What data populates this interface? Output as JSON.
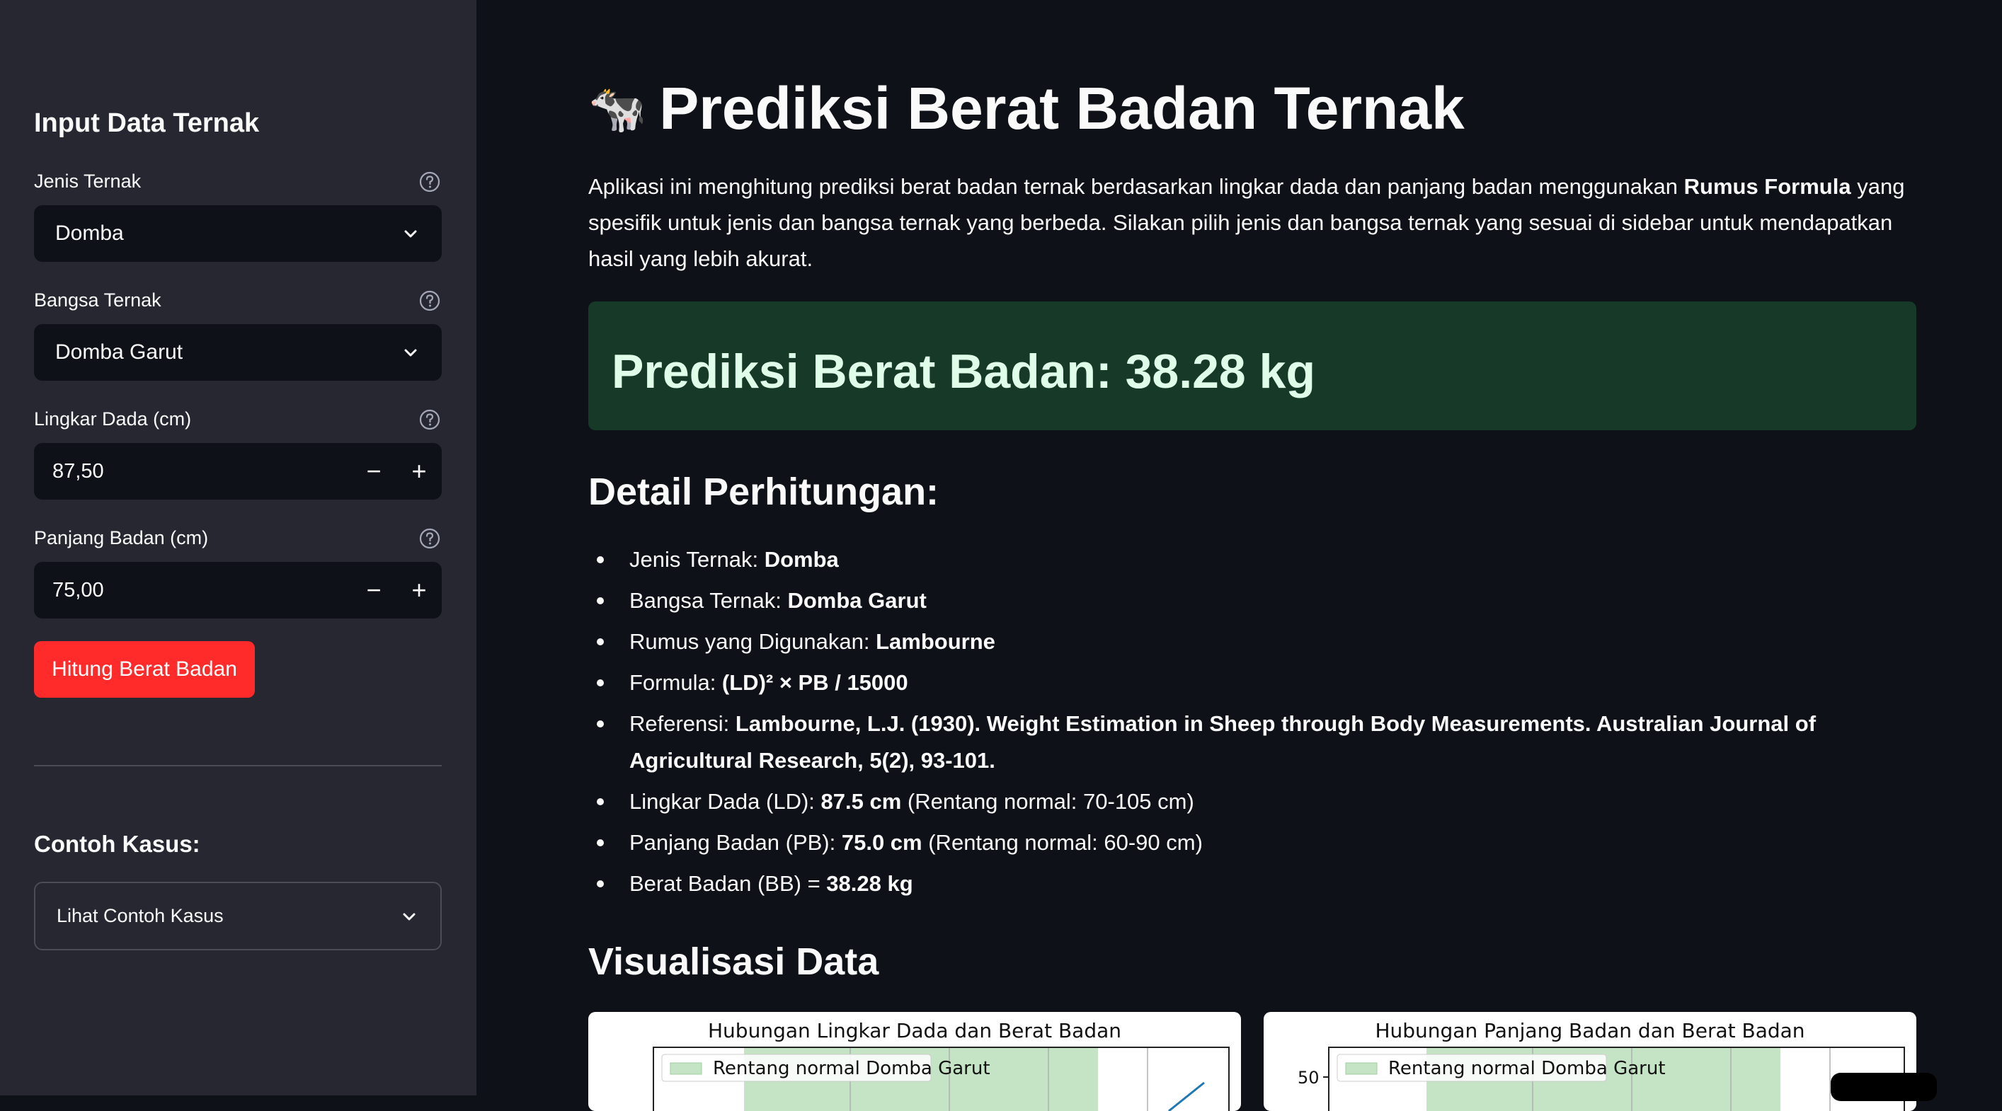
{
  "sidebar": {
    "title": "Input Data Ternak",
    "jenis": {
      "label": "Jenis Ternak",
      "value": "Domba"
    },
    "bangsa": {
      "label": "Bangsa Ternak",
      "value": "Domba Garut"
    },
    "lingkar": {
      "label": "Lingkar Dada (cm)",
      "value": "87,50"
    },
    "panjang": {
      "label": "Panjang Badan (cm)",
      "value": "75,00"
    },
    "button_label": "Hitung Berat Badan",
    "contoh_title": "Contoh Kasus:",
    "contoh_expander": "Lihat Contoh Kasus",
    "stepper_minus": "−",
    "stepper_plus": "+"
  },
  "main": {
    "title_icon": "🐄",
    "title": "Prediksi Berat Badan Ternak",
    "intro_1": "Aplikasi ini menghitung prediksi berat badan ternak berdasarkan lingkar dada dan panjang badan menggunakan ",
    "intro_bold": "Rumus Formula",
    "intro_2": " yang spesifik untuk jenis dan bangsa ternak yang berbeda. Silakan pilih jenis dan bangsa ternak yang sesuai di sidebar untuk mendapatkan hasil yang lebih akurat.",
    "result": "Prediksi Berat Badan: 38.28 kg",
    "detail_title": "Detail Perhitungan:",
    "details": [
      {
        "label": "Jenis Ternak: ",
        "value": "Domba",
        "suffix": ""
      },
      {
        "label": "Bangsa Ternak: ",
        "value": "Domba Garut",
        "suffix": ""
      },
      {
        "label": "Rumus yang Digunakan: ",
        "value": "Lambourne",
        "suffix": ""
      },
      {
        "label": "Formula: ",
        "value": "(LD)² × PB / 15000",
        "suffix": ""
      },
      {
        "label": "Referensi: ",
        "value": "Lambourne, L.J. (1930). Weight Estimation in Sheep through Body Measurements. Australian Journal of Agricultural Research, 5(2), 93-101.",
        "suffix": ""
      },
      {
        "label": "Lingkar Dada (LD): ",
        "value": "87.5 cm",
        "suffix": " (Rentang normal: 70-105 cm)"
      },
      {
        "label": "Panjang Badan (PB): ",
        "value": "75.0 cm",
        "suffix": " (Rentang normal: 60-90 cm)"
      },
      {
        "label": "Berat Badan (BB) = ",
        "value": "38.28 kg",
        "suffix": ""
      }
    ],
    "viz_title": "Visualisasi Data",
    "chart1": {
      "title": "Hubungan Lingkar Dada dan Berat Badan",
      "legend": "Rentang normal Domba Garut"
    },
    "chart2": {
      "title": "Hubungan Panjang Badan dan Berat Badan",
      "legend": "Rentang normal Domba Garut",
      "ytick": "50"
    }
  },
  "colors": {
    "sidebar_bg": "#262730",
    "main_bg": "#0e1117",
    "primary_button": "#ff2b2b",
    "success_bg": "#173928",
    "success_text": "#dffde9",
    "normal_range_fill": "#c5e3c5",
    "line": "#1f77b4"
  },
  "icons": [
    "help-icon",
    "chevron-down-icon",
    "minus-icon",
    "plus-icon",
    "cow-icon"
  ]
}
